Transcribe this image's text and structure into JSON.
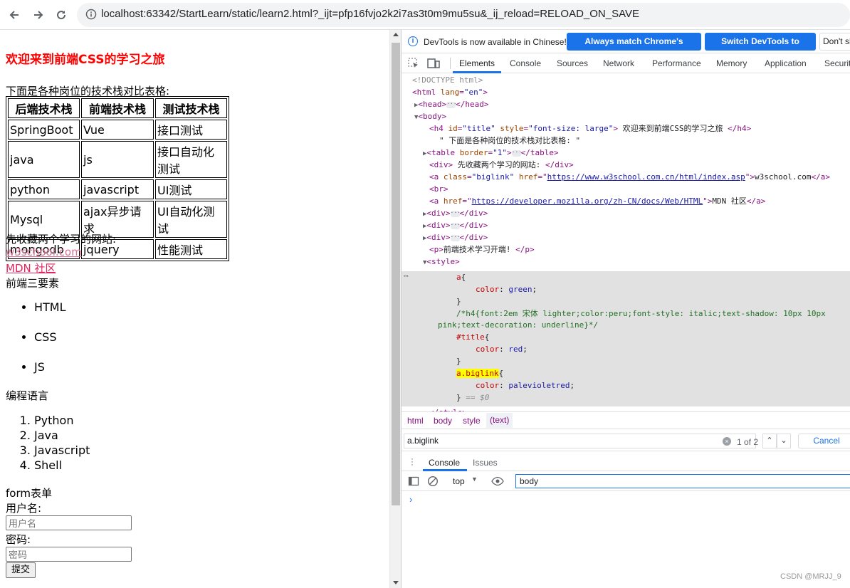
{
  "browser": {
    "url": "localhost:63342/StartLearn/static/learn2.html?_ijt=pfp16fvjo2k2i7as3t0m9mu5su&_ij_reload=RELOAD_ON_SAVE"
  },
  "page": {
    "title": "欢迎来到前端CSS的学习之旅",
    "intro": "下面是各种岗位的技术栈对比表格:",
    "table": {
      "headers": [
        "后端技术栈",
        "前端技术栈",
        "测试技术栈"
      ],
      "rows": [
        [
          "SpringBoot",
          "Vue",
          "接口测试"
        ],
        [
          "java",
          "js",
          "接口自动化测试"
        ],
        [
          "python",
          "javascript",
          "UI测试"
        ],
        [
          "Mysql",
          "ajax异步请求",
          "UI自动化测试"
        ],
        [
          "mongodb",
          "jquery",
          "性能测试"
        ]
      ]
    },
    "collect": "先收藏两个学习的网站:",
    "links": [
      "w3school.com",
      "MDN 社区"
    ],
    "three_title": "前端三要素",
    "three_items": [
      "HTML",
      "CSS",
      "JS"
    ],
    "lang_title": "编程语言",
    "lang_items": [
      "Python",
      "Java",
      "Javascript",
      "Shell"
    ],
    "form": {
      "title": "form表单",
      "user_label": "用户名:",
      "user_placeholder": "用户名",
      "pwd_label": "密码:",
      "pwd_placeholder": "密码",
      "submit": "提交"
    }
  },
  "devtools": {
    "info_msg": "DevTools is now available in Chinese!",
    "btn_match": "Always match Chrome's language",
    "btn_switch": "Switch DevTools to Chinese",
    "btn_dont": "Don't sh",
    "tabs": [
      "Elements",
      "Console",
      "Sources",
      "Network",
      "Performance",
      "Memory",
      "Application",
      "Securit"
    ],
    "dom": {
      "doctype": "<!DOCTYPE html>",
      "h4_text": " 欢迎来到前端CSS的学习之旅 ",
      "body_text": "\" 下面是各种岗位的技术栈对比表格: \"",
      "div_text": " 先收藏两个学习的网站: ",
      "w3_href": "https://www.w3school.com.cn/html/index.asp",
      "w3_text": "w3school.com",
      "mdn_href": "https://developer.mozilla.org/zh-CN/docs/Web/HTML",
      "mdn_text": "MDN 社区",
      "p_text": "前端技术学习开端! ",
      "css_comment": "/*h4{font:2em 宋体 lighter;color:peru;font-style: italic;text-shadow: 10px 10px",
      "css_comment2": "pink;text-decoration: underline}*/",
      "eq0": "== $0"
    },
    "crumbs": [
      "html",
      "body",
      "style",
      "(text)"
    ],
    "search_value": "a.biglink",
    "search_count": "1 of 2",
    "cancel": "Cancel",
    "drawer_tabs": [
      "Console",
      "Issues"
    ],
    "context": "top",
    "filter": "body",
    "watermark": "CSDN @MRJJ_9"
  }
}
